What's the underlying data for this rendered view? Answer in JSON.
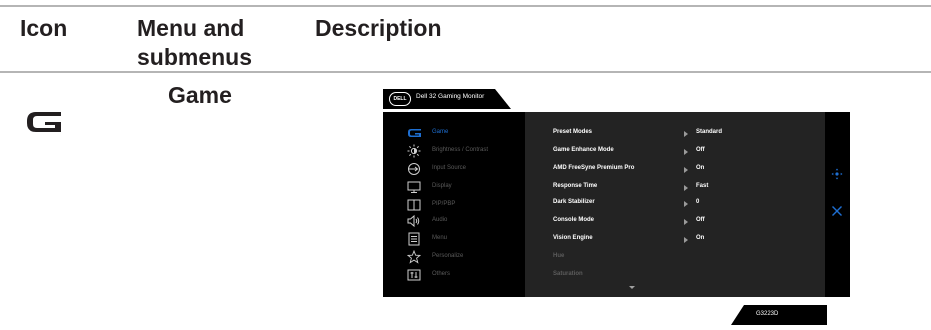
{
  "table": {
    "headers": [
      "Icon",
      "Menu and",
      "submenus",
      "Description"
    ],
    "game_title": "Game"
  },
  "osd": {
    "brand": "DELL",
    "title": "Dell 32 Gaming Monitor",
    "left_menu": [
      "Game",
      "Brightness / Contrast",
      "Input Source",
      "Display",
      "PIP/PBP",
      "Audio",
      "Menu",
      "Personalize",
      "Others"
    ],
    "rows": [
      {
        "label": "Preset Modes",
        "value": "Standard"
      },
      {
        "label": "Game Enhance Mode",
        "value": "Off"
      },
      {
        "label": "AMD FreeSyne Premium Pro",
        "value": "On"
      },
      {
        "label": "Response Time",
        "value": "Fast"
      },
      {
        "label": "Dark Stabilizer",
        "value": "0"
      },
      {
        "label": "Console Mode",
        "value": "Off"
      },
      {
        "label": "Vision Engine",
        "value": "On"
      },
      {
        "label": "Hue",
        "value": ""
      },
      {
        "label": "Saturation",
        "value": ""
      }
    ],
    "model": "G3223D",
    "accent_color": "#1e6fd2"
  }
}
